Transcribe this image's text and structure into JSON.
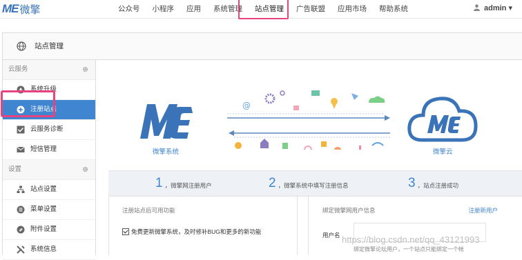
{
  "brand": {
    "logo_mark": "ME",
    "logo_text": "微擎"
  },
  "nav": {
    "items": [
      "公众号",
      "小程序",
      "应用",
      "系统管理",
      "站点管理",
      "广告联盟",
      "应用市场",
      "帮助系统"
    ],
    "active_index": 4
  },
  "user": {
    "name": "admin",
    "caret": "▾"
  },
  "page": {
    "title": "站点管理"
  },
  "sidebar": {
    "section1": "云服务",
    "section1_items": [
      "系统升级",
      "注册站点",
      "云服务诊断",
      "短信管理"
    ],
    "active_item": "注册站点",
    "section2": "设置",
    "section2_items": [
      "站点设置",
      "菜单设置",
      "附件设置",
      "系统信息"
    ]
  },
  "hero": {
    "left_label": "微擎系统",
    "right_label": "微擎云",
    "mark": "ME"
  },
  "steps": [
    {
      "num": "1",
      "text": "，微擎网注册用户"
    },
    {
      "num": "2",
      "text": "，微擎系统中填写注册信息"
    },
    {
      "num": "3",
      "text": "，站点注册成功"
    }
  ],
  "left_panel": {
    "title": "注册站点后可用功能",
    "feature": "免费更新微擎系统，及时修补BUG和更多的新功能"
  },
  "right_panel": {
    "title": "绑定微擎网用户信息",
    "register_link": "注册新用户",
    "username_label": "用户名",
    "hint": "绑定微擎论坛用户，一个站点只能绑定一个帐"
  },
  "watermark": "https://blog.csdn.net/qq_43121993",
  "colors": {
    "accent": "#3f85cf",
    "highlight": "#e8437f"
  }
}
